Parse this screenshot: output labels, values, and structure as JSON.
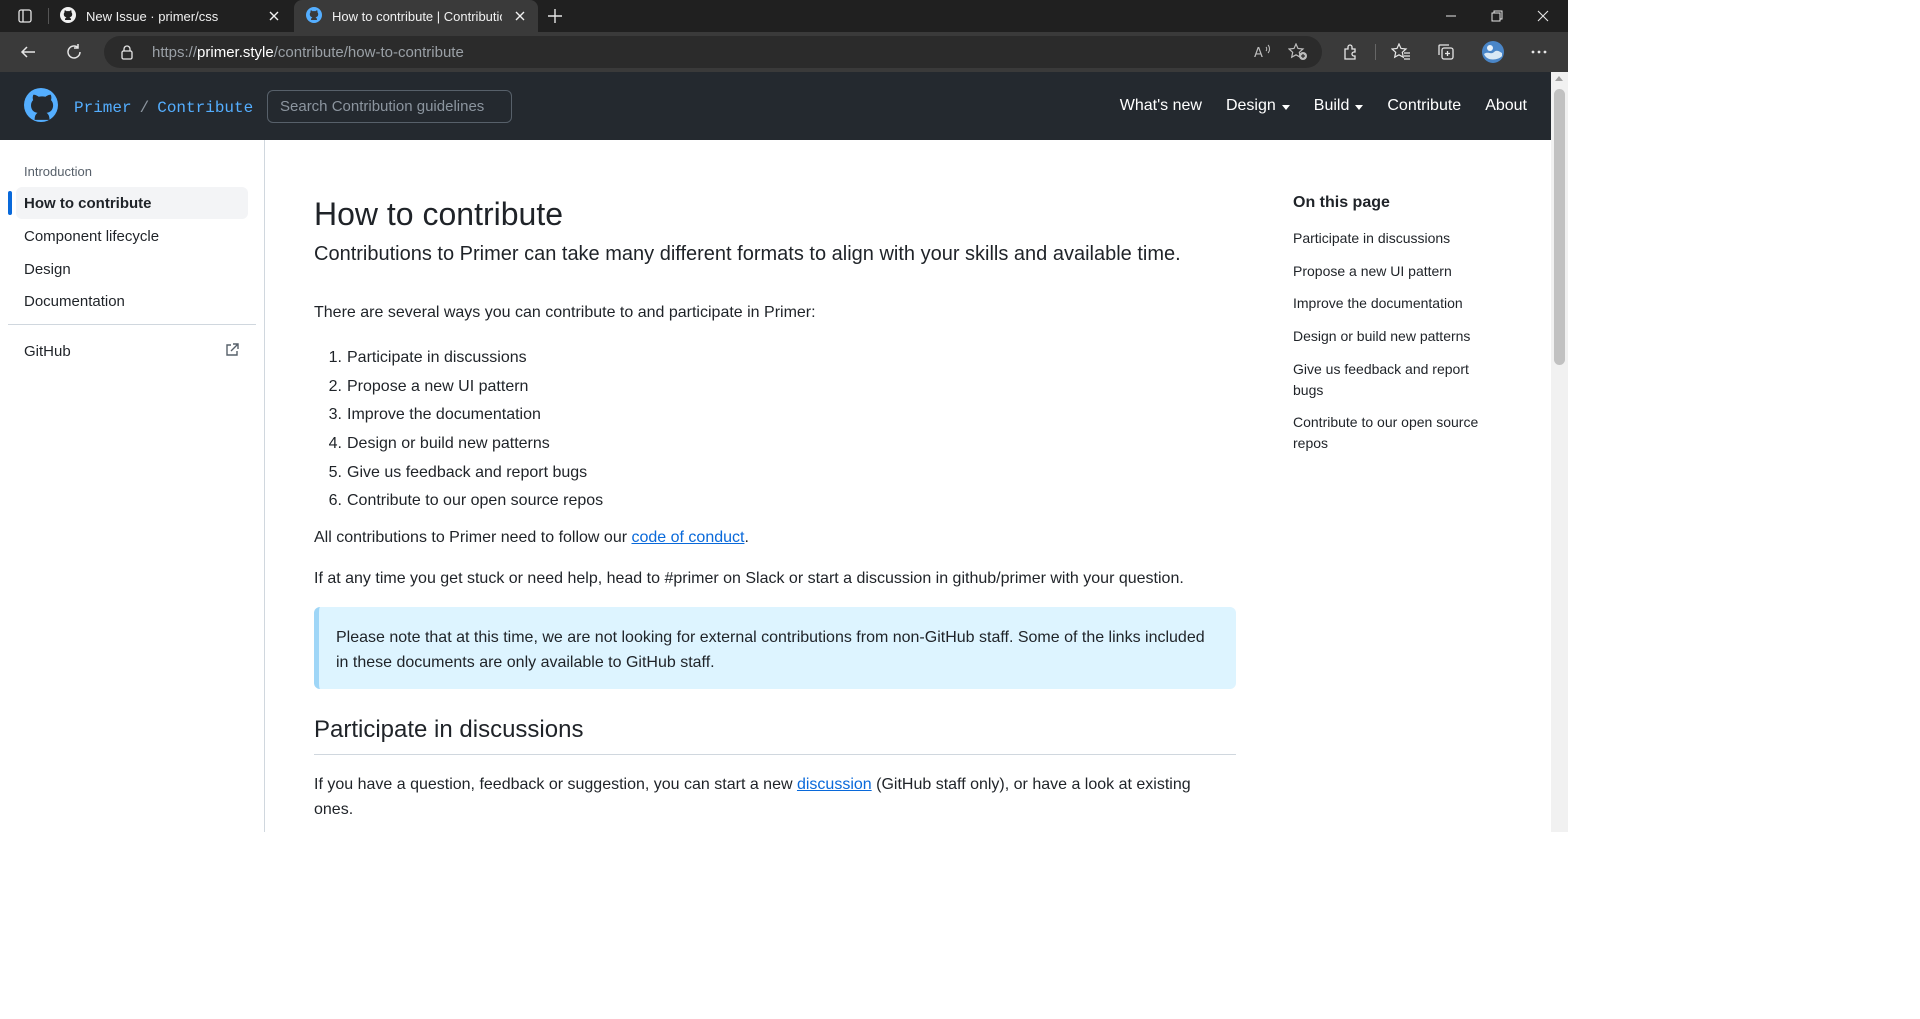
{
  "browser": {
    "tabs": [
      {
        "title": "New Issue · primer/css",
        "active": false
      },
      {
        "title": "How to contribute | Contribution",
        "active": true
      }
    ],
    "url": {
      "scheme": "https://",
      "host": "primer.style",
      "path": "/contribute/how-to-contribute"
    },
    "toolbar_icons": [
      "read-aloud-icon",
      "favorite-add-icon",
      "extensions-icon",
      "favorites-icon",
      "collections-icon",
      "profile-avatar",
      "more-icon"
    ],
    "colors": {
      "tabstrip": "#202020",
      "toolbar": "#3a3a3a"
    }
  },
  "site_header": {
    "brand_primary": "Primer",
    "brand_separator": "/",
    "brand_secondary": "Contribute",
    "search_placeholder": "Search Contribution guidelines",
    "nav": [
      {
        "label": "What's new",
        "dropdown": false
      },
      {
        "label": "Design",
        "dropdown": true
      },
      {
        "label": "Build",
        "dropdown": true
      },
      {
        "label": "Contribute",
        "dropdown": false
      },
      {
        "label": "About",
        "dropdown": false
      }
    ],
    "colors": {
      "background": "#24292f",
      "brand": "#54aeff"
    }
  },
  "sidebar": {
    "heading": "Introduction",
    "items": [
      {
        "label": "How to contribute",
        "active": true
      },
      {
        "label": "Component lifecycle",
        "active": false
      },
      {
        "label": "Design",
        "active": false
      },
      {
        "label": "Documentation",
        "active": false
      }
    ],
    "external": {
      "label": "GitHub"
    }
  },
  "main": {
    "title": "How to contribute",
    "lead": "Contributions to Primer can take many different formats to align with your skills and available time.",
    "intro": "There are several ways you can contribute to and participate in Primer:",
    "list": [
      "Participate in discussions",
      "Propose a new UI pattern",
      "Improve the documentation",
      "Design or build new patterns",
      "Give us feedback and report bugs",
      "Contribute to our open source repos"
    ],
    "list_numbers": [
      "1.",
      "2.",
      "3.",
      "4.",
      "5.",
      "6."
    ],
    "conduct": {
      "before": "All contributions to Primer need to follow our ",
      "link": "code of conduct",
      "after": "."
    },
    "help": "If at any time you get stuck or need help, head to #primer on Slack or start a discussion in github/primer with your question.",
    "note": "Please note that at this time, we are not looking for external contributions from non-GitHub staff. Some of the links included in these documents are only available to GitHub staff.",
    "section_title": "Participate in discussions",
    "section_text": {
      "before": "If you have a question, feedback or suggestion, you can start a new ",
      "link": "discussion",
      "after": " (GitHub staff only), or have a look at existing ones."
    },
    "colors": {
      "link": "#0969da",
      "note_background": "#ddf4ff"
    }
  },
  "toc": {
    "title": "On this page",
    "items": [
      "Participate in discussions",
      "Propose a new UI pattern",
      "Improve the documentation",
      "Design or build new patterns",
      "Give us feedback and report bugs",
      "Contribute to our open source repos"
    ]
  }
}
